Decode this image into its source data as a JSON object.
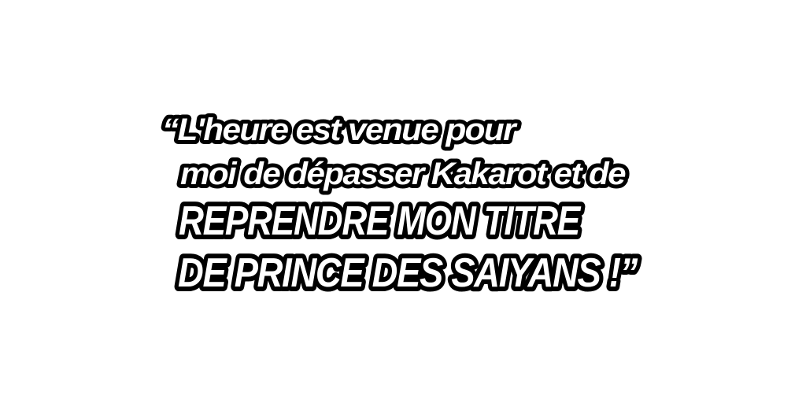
{
  "quote": {
    "line1": "“L'heure est venue pour",
    "line2": "moi de dépasser Kakarot et de",
    "line3": "REPRENDRE MON TITRE",
    "line4": "DE PRINCE DES SAIYANS !”"
  },
  "colors": {
    "background": "#ffffff",
    "text_fill": "#ffffff",
    "text_outline": "#000000"
  }
}
